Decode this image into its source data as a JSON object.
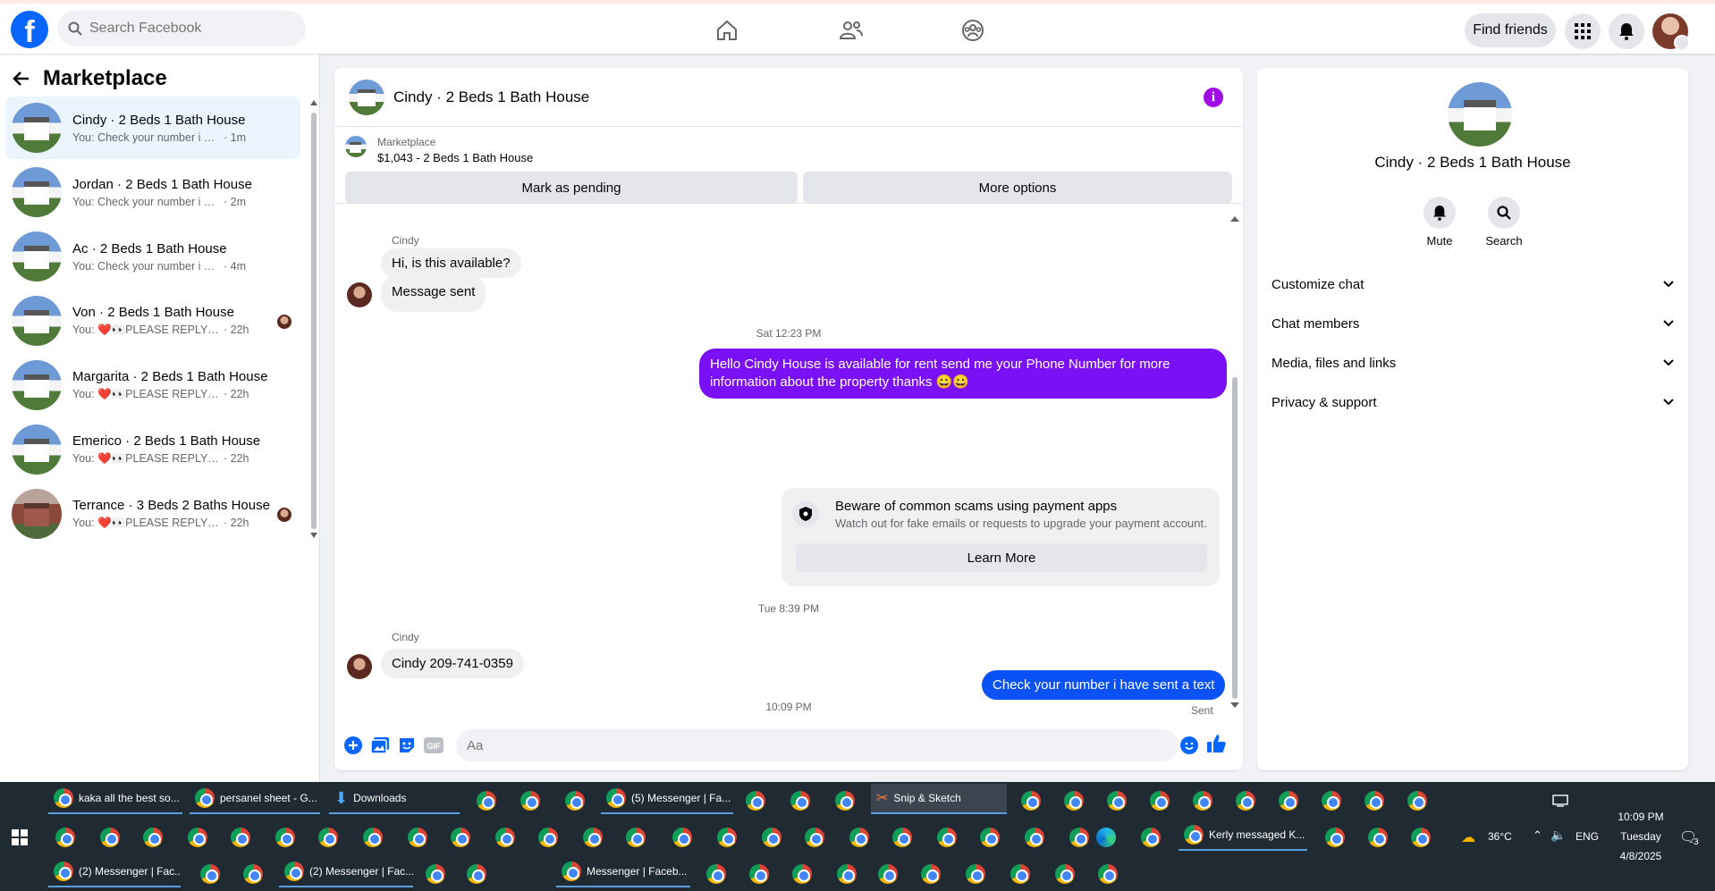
{
  "topbar": {
    "logo": "f",
    "search_placeholder": "Search Facebook",
    "find_friends": "Find friends",
    "icons": [
      "home-icon",
      "friends-icon",
      "groups-icon",
      "menu-grid-icon",
      "bell-icon"
    ]
  },
  "sidebar": {
    "title": "Marketplace",
    "conversations": [
      {
        "name": "Cindy · 2 Beds 1 Bath House",
        "preview": "You: Check your number i have se...",
        "time": "· 1m"
      },
      {
        "name": "Jordan · 2 Beds 1 Bath House",
        "preview": "You: Check your number i have se...",
        "time": "· 2m"
      },
      {
        "name": "Ac · 2 Beds 1 Bath House",
        "preview": "You: Check your number i have se...",
        "time": "· 4m"
      },
      {
        "name": "Von · 2 Beds 1 Bath House",
        "preview": "You: ❤️👀PLEASE REPLY MUST...",
        "time": "· 22h"
      },
      {
        "name": "Margarita · 2 Beds 1 Bath House",
        "preview": "You: ❤️👀PLEASE REPLY MUST W...",
        "time": "· 22h"
      },
      {
        "name": "Emerico · 2 Beds 1 Bath House",
        "preview": "You: ❤️👀PLEASE REPLY MUST W...",
        "time": "· 22h"
      },
      {
        "name": "Terrance · 3 Beds 2 Baths House",
        "preview": "You: ❤️👀PLEASE REPLY MUST...",
        "time": "· 22h"
      }
    ]
  },
  "chat": {
    "title": "Cindy · 2 Beds 1 Bath House",
    "marketplace_label": "Marketplace",
    "listing": "$1,043 - 2 Beds 1 Bath House",
    "mark_pending": "Mark as pending",
    "more_options": "More options",
    "sender1": "Cindy",
    "msg1": "Hi, is this available?",
    "msg2": "Message sent",
    "ts1": "Sat 12:23 PM",
    "out1": "Hello Cindy  House is available for rent send me your Phone Number for more information about the property thanks 😀😀",
    "scam_title": "Beware of common scams using payment apps",
    "scam_sub": "Watch out for fake emails or requests to upgrade your payment account.",
    "learn_more": "Learn More",
    "ts2": "Tue 8:39 PM",
    "sender2": "Cindy",
    "msg3": "Cindy 209-741-0359",
    "ts3": "10:09 PM",
    "out2": "Check your number i have sent a text",
    "sent_status": "Sent",
    "composer_placeholder": "Aa"
  },
  "details": {
    "name": "Cindy · 2 Beds 1 Bath House",
    "mute": "Mute",
    "search": "Search",
    "rows": [
      "Customize chat",
      "Chat members",
      "Media, files and links",
      "Privacy & support"
    ]
  },
  "taskbar": {
    "row1": [
      "kaka all the best so...",
      "persanel sheet - G...",
      "Downloads",
      "(5) Messenger | Fa...",
      "Snip & Sketch"
    ],
    "row2": [
      "Kerly messaged K..."
    ],
    "row3": [
      "(2) Messenger | Fac...",
      "(2) Messenger | Fac...",
      "Messenger | Faceb..."
    ],
    "weather": "36°C",
    "lang": "ENG",
    "time": "10:09 PM",
    "day": "Tuesday",
    "date": "4/8/2025",
    "notif_count": "3"
  }
}
